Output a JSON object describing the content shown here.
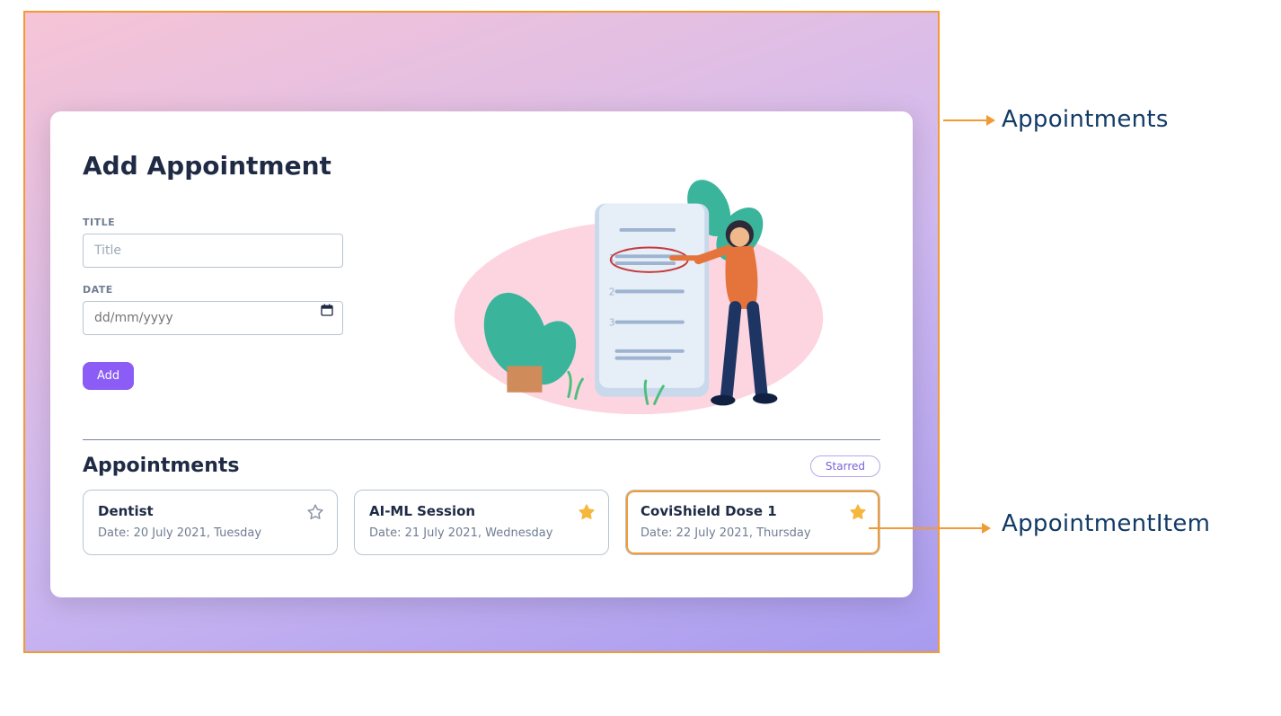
{
  "annotations": {
    "component_outer": "Appointments",
    "component_item": "AppointmentItem"
  },
  "form": {
    "heading": "Add Appointment",
    "title_label": "TITLE",
    "title_placeholder": "Title",
    "date_label": "DATE",
    "date_placeholder": "dd/mm/yyyy",
    "add_button": "Add"
  },
  "list": {
    "heading": "Appointments",
    "filter_label": "Starred",
    "date_prefix": "Date:",
    "items": [
      {
        "title": "Dentist",
        "date": "20 July 2021, Tuesday",
        "starred": false,
        "highlight": false
      },
      {
        "title": "AI-ML Session",
        "date": "21 July 2021, Wednesday",
        "starred": true,
        "highlight": false
      },
      {
        "title": "CoviShield Dose 1",
        "date": "22 July 2021, Thursday",
        "starred": true,
        "highlight": true
      }
    ]
  },
  "colors": {
    "accent": "#8b5cf6",
    "star": "#f5b83d",
    "annotation": "#f29a33"
  }
}
